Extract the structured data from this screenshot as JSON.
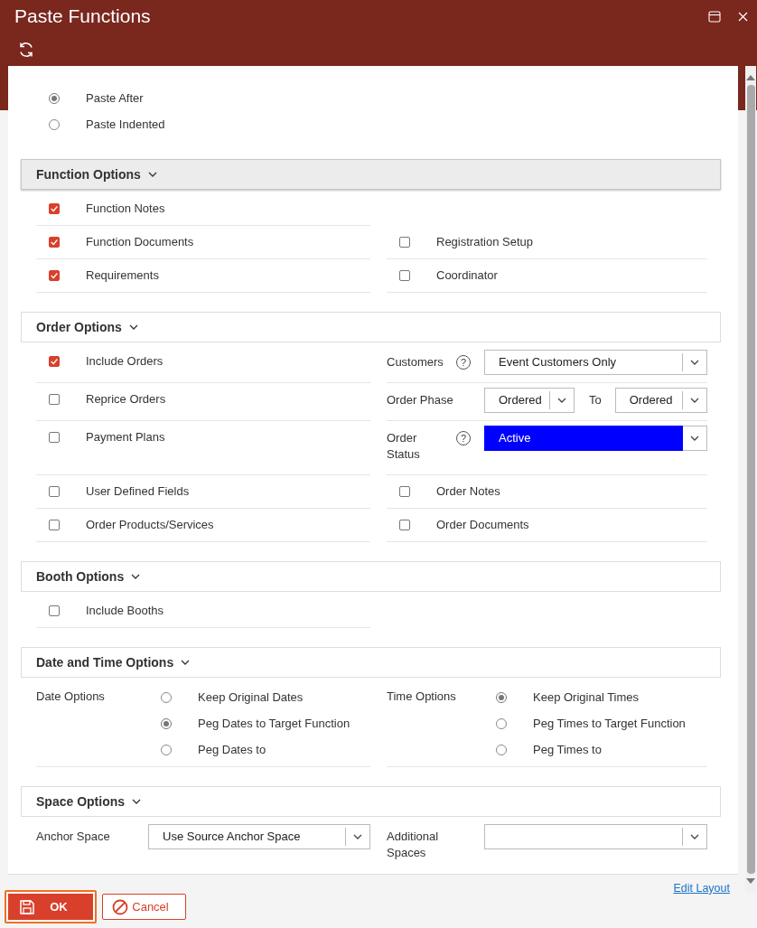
{
  "window": {
    "title": "Paste Functions"
  },
  "paste_mode": [
    {
      "label": "Paste After",
      "selected": true
    },
    {
      "label": "Paste Indented",
      "selected": false
    }
  ],
  "sections": [
    {
      "title": "Function Options",
      "active": true,
      "rows": [
        {
          "left": {
            "kind": "checkbox",
            "label": "Function Notes",
            "checked": true
          }
        },
        {
          "left": {
            "kind": "checkbox",
            "label": "Function Documents",
            "checked": true
          },
          "right": {
            "kind": "checkbox",
            "label": "Registration Setup",
            "checked": false
          }
        },
        {
          "left": {
            "kind": "checkbox",
            "label": "Requirements",
            "checked": true
          },
          "right": {
            "kind": "checkbox",
            "label": "Coordinator",
            "checked": false
          }
        }
      ]
    },
    {
      "title": "Order Options",
      "active": false,
      "rows": [
        {
          "left": {
            "kind": "checkbox",
            "label": "Include Orders",
            "checked": true
          },
          "right": {
            "kind": "select",
            "label": "Customers",
            "help": "?",
            "value": "Event Customers Only",
            "highlighted": false
          }
        },
        {
          "left": {
            "kind": "checkbox",
            "label": "Reprice Orders",
            "checked": false
          },
          "right": {
            "kind": "range",
            "label": "Order Phase",
            "from": "Ordered",
            "to_label": "To",
            "to": "Ordered"
          }
        },
        {
          "left": {
            "kind": "checkbox",
            "label": "Payment Plans",
            "checked": false
          },
          "right": {
            "kind": "select",
            "label": "Order Status",
            "help": "?",
            "value": "Active",
            "highlighted": true
          }
        },
        {
          "left": {
            "kind": "checkbox",
            "label": "User Defined Fields",
            "checked": false
          },
          "right": {
            "kind": "checkbox",
            "label": "Order Notes",
            "checked": false
          }
        },
        {
          "left": {
            "kind": "checkbox",
            "label": "Order Products/Services",
            "checked": false
          },
          "right": {
            "kind": "checkbox",
            "label": "Order Documents",
            "checked": false
          }
        }
      ]
    },
    {
      "title": "Booth Options",
      "active": false,
      "rows": [
        {
          "left": {
            "kind": "checkbox",
            "label": "Include Booths",
            "checked": false
          }
        }
      ]
    },
    {
      "title": "Date and Time Options",
      "active": false,
      "rows": [
        {
          "left": {
            "kind": "radios",
            "label": "Date Options",
            "options": [
              {
                "label": "Keep Original Dates",
                "selected": false
              },
              {
                "label": "Peg Dates to Target Function",
                "selected": true
              },
              {
                "label": "Peg Dates to",
                "selected": false
              }
            ]
          },
          "right": {
            "kind": "radios",
            "label": "Time Options",
            "options": [
              {
                "label": "Keep Original Times",
                "selected": true
              },
              {
                "label": "Peg Times to Target Function",
                "selected": false
              },
              {
                "label": "Peg Times to",
                "selected": false
              }
            ]
          }
        }
      ]
    },
    {
      "title": "Space Options",
      "active": false,
      "rows": [
        {
          "left": {
            "kind": "select",
            "label": "Anchor Space",
            "value": "Use Source Anchor Space",
            "highlighted": false
          },
          "right": {
            "kind": "select",
            "label": "Additional Spaces",
            "highlighted": false
          }
        }
      ]
    }
  ],
  "edit_layout_link": "Edit Layout",
  "buttons": [
    {
      "label": "OK",
      "kind": "primary",
      "focused": true
    },
    {
      "label": "Cancel",
      "kind": "secondary",
      "focused": false
    }
  ]
}
